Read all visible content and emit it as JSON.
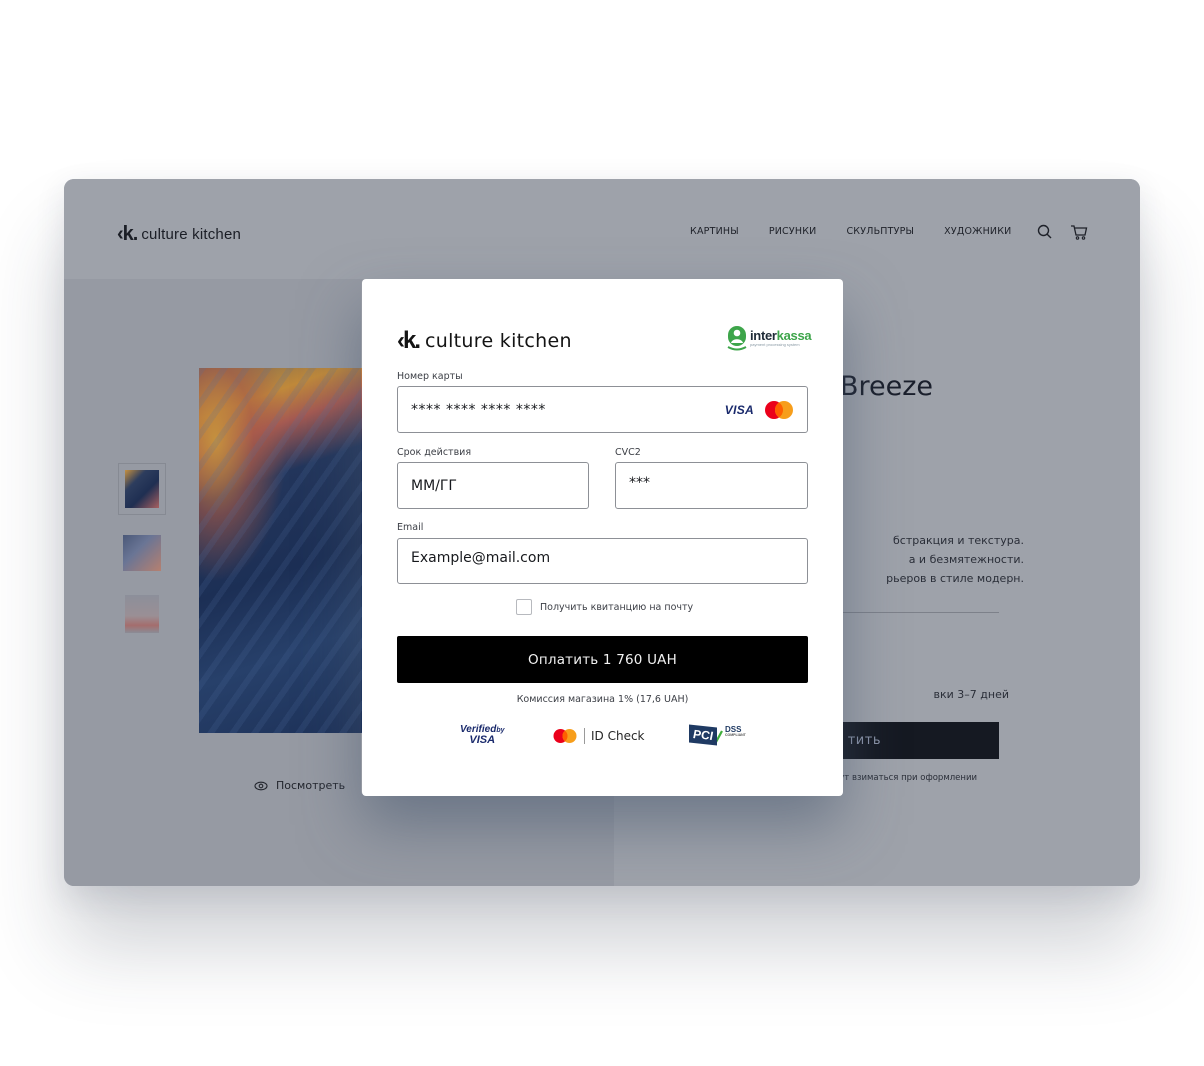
{
  "site": {
    "logo_mark": "‹k.",
    "logo_text": "culture kitchen",
    "nav": [
      "КАРТИНЫ",
      "РИСУНКИ",
      "СКУЛЬПТУРЫ",
      "ХУДОЖНИКИ"
    ],
    "icons": [
      "search-icon",
      "cart-icon"
    ],
    "product": {
      "title_visible": "Breeze",
      "description_lines": [
        "бстракция и текстура.",
        "а и безмятежности.",
        "рьеров в стиле модерн."
      ],
      "delivery_text": "вки 3–7 дней",
      "buy_button_label": "тить",
      "buy_note": "дут взиматься при оформлении"
    },
    "view_link": "Посмотреть",
    "thumbnails_count": 3
  },
  "modal": {
    "logo_mark": "‹k.",
    "logo_text": "culture kitchen",
    "provider": {
      "name_part1": "inter",
      "name_part2": "kassa",
      "tagline": "payment processing system"
    },
    "card_number": {
      "label": "Номер карты",
      "value": "**** **** **** ****",
      "brands": [
        "VISA",
        "Mastercard"
      ]
    },
    "expiry": {
      "label": "Срок действия",
      "value": "ММ/ГГ"
    },
    "cvc": {
      "label": "CVC2",
      "value": "***"
    },
    "email": {
      "label": "Email",
      "value": "Example@mail.com"
    },
    "receipt_checkbox": {
      "label": "Получить квитанцию на почту",
      "checked": false
    },
    "pay_button_label": "Оплатить 1 760 UAH",
    "commission_text": "Комиссия магазина 1% (17,6 UAH)",
    "trust_badges": {
      "verified_by": "Verified",
      "verified_by_small": "by",
      "verified_visa": "VISA",
      "id_check": "ID Check",
      "pci": "PCI",
      "pci_dss": "DSS",
      "pci_compliant": "COMPLIANT"
    }
  },
  "colors": {
    "overlay_bg": "#9ea2aa",
    "pay_button_bg": "#000000",
    "interkassa_green": "#3da54a",
    "mastercard_red": "#eb001b",
    "mastercard_orange": "#f79e1b",
    "visa_blue": "#1a2a6c"
  }
}
